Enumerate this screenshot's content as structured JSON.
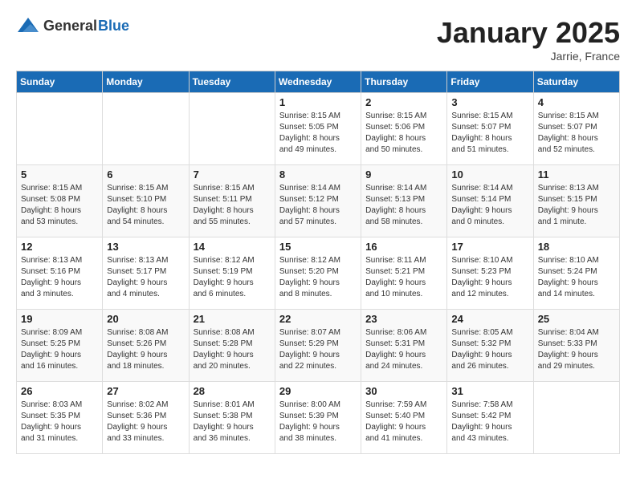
{
  "logo": {
    "text_general": "General",
    "text_blue": "Blue"
  },
  "title": "January 2025",
  "location": "Jarrie, France",
  "days_of_week": [
    "Sunday",
    "Monday",
    "Tuesday",
    "Wednesday",
    "Thursday",
    "Friday",
    "Saturday"
  ],
  "weeks": [
    [
      {
        "day": "",
        "info": ""
      },
      {
        "day": "",
        "info": ""
      },
      {
        "day": "",
        "info": ""
      },
      {
        "day": "1",
        "info": "Sunrise: 8:15 AM\nSunset: 5:05 PM\nDaylight: 8 hours\nand 49 minutes."
      },
      {
        "day": "2",
        "info": "Sunrise: 8:15 AM\nSunset: 5:06 PM\nDaylight: 8 hours\nand 50 minutes."
      },
      {
        "day": "3",
        "info": "Sunrise: 8:15 AM\nSunset: 5:07 PM\nDaylight: 8 hours\nand 51 minutes."
      },
      {
        "day": "4",
        "info": "Sunrise: 8:15 AM\nSunset: 5:07 PM\nDaylight: 8 hours\nand 52 minutes."
      }
    ],
    [
      {
        "day": "5",
        "info": "Sunrise: 8:15 AM\nSunset: 5:08 PM\nDaylight: 8 hours\nand 53 minutes."
      },
      {
        "day": "6",
        "info": "Sunrise: 8:15 AM\nSunset: 5:10 PM\nDaylight: 8 hours\nand 54 minutes."
      },
      {
        "day": "7",
        "info": "Sunrise: 8:15 AM\nSunset: 5:11 PM\nDaylight: 8 hours\nand 55 minutes."
      },
      {
        "day": "8",
        "info": "Sunrise: 8:14 AM\nSunset: 5:12 PM\nDaylight: 8 hours\nand 57 minutes."
      },
      {
        "day": "9",
        "info": "Sunrise: 8:14 AM\nSunset: 5:13 PM\nDaylight: 8 hours\nand 58 minutes."
      },
      {
        "day": "10",
        "info": "Sunrise: 8:14 AM\nSunset: 5:14 PM\nDaylight: 9 hours\nand 0 minutes."
      },
      {
        "day": "11",
        "info": "Sunrise: 8:13 AM\nSunset: 5:15 PM\nDaylight: 9 hours\nand 1 minute."
      }
    ],
    [
      {
        "day": "12",
        "info": "Sunrise: 8:13 AM\nSunset: 5:16 PM\nDaylight: 9 hours\nand 3 minutes."
      },
      {
        "day": "13",
        "info": "Sunrise: 8:13 AM\nSunset: 5:17 PM\nDaylight: 9 hours\nand 4 minutes."
      },
      {
        "day": "14",
        "info": "Sunrise: 8:12 AM\nSunset: 5:19 PM\nDaylight: 9 hours\nand 6 minutes."
      },
      {
        "day": "15",
        "info": "Sunrise: 8:12 AM\nSunset: 5:20 PM\nDaylight: 9 hours\nand 8 minutes."
      },
      {
        "day": "16",
        "info": "Sunrise: 8:11 AM\nSunset: 5:21 PM\nDaylight: 9 hours\nand 10 minutes."
      },
      {
        "day": "17",
        "info": "Sunrise: 8:10 AM\nSunset: 5:23 PM\nDaylight: 9 hours\nand 12 minutes."
      },
      {
        "day": "18",
        "info": "Sunrise: 8:10 AM\nSunset: 5:24 PM\nDaylight: 9 hours\nand 14 minutes."
      }
    ],
    [
      {
        "day": "19",
        "info": "Sunrise: 8:09 AM\nSunset: 5:25 PM\nDaylight: 9 hours\nand 16 minutes."
      },
      {
        "day": "20",
        "info": "Sunrise: 8:08 AM\nSunset: 5:26 PM\nDaylight: 9 hours\nand 18 minutes."
      },
      {
        "day": "21",
        "info": "Sunrise: 8:08 AM\nSunset: 5:28 PM\nDaylight: 9 hours\nand 20 minutes."
      },
      {
        "day": "22",
        "info": "Sunrise: 8:07 AM\nSunset: 5:29 PM\nDaylight: 9 hours\nand 22 minutes."
      },
      {
        "day": "23",
        "info": "Sunrise: 8:06 AM\nSunset: 5:31 PM\nDaylight: 9 hours\nand 24 minutes."
      },
      {
        "day": "24",
        "info": "Sunrise: 8:05 AM\nSunset: 5:32 PM\nDaylight: 9 hours\nand 26 minutes."
      },
      {
        "day": "25",
        "info": "Sunrise: 8:04 AM\nSunset: 5:33 PM\nDaylight: 9 hours\nand 29 minutes."
      }
    ],
    [
      {
        "day": "26",
        "info": "Sunrise: 8:03 AM\nSunset: 5:35 PM\nDaylight: 9 hours\nand 31 minutes."
      },
      {
        "day": "27",
        "info": "Sunrise: 8:02 AM\nSunset: 5:36 PM\nDaylight: 9 hours\nand 33 minutes."
      },
      {
        "day": "28",
        "info": "Sunrise: 8:01 AM\nSunset: 5:38 PM\nDaylight: 9 hours\nand 36 minutes."
      },
      {
        "day": "29",
        "info": "Sunrise: 8:00 AM\nSunset: 5:39 PM\nDaylight: 9 hours\nand 38 minutes."
      },
      {
        "day": "30",
        "info": "Sunrise: 7:59 AM\nSunset: 5:40 PM\nDaylight: 9 hours\nand 41 minutes."
      },
      {
        "day": "31",
        "info": "Sunrise: 7:58 AM\nSunset: 5:42 PM\nDaylight: 9 hours\nand 43 minutes."
      },
      {
        "day": "",
        "info": ""
      }
    ]
  ]
}
